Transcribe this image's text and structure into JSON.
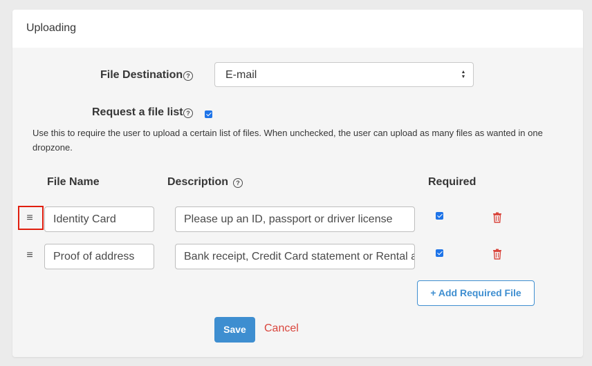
{
  "panel": {
    "title": "Uploading"
  },
  "destination": {
    "label": "File Destination",
    "help_icon": "question-circle-icon",
    "selected": "E-mail"
  },
  "file_list": {
    "label": "Request a file list",
    "help_icon": "question-circle-icon",
    "checked": true,
    "description": "Use this to require the user to upload a certain list of files. When unchecked, the user can upload as many files as wanted in one dropzone."
  },
  "table": {
    "headers": {
      "file_name": "File Name",
      "description": "Description",
      "required": "Required"
    },
    "rows": [
      {
        "file_name": "Identity Card",
        "description": "Please up an ID, passport or driver license",
        "required": true
      },
      {
        "file_name": "Proof of address",
        "description": "Bank receipt, Credit Card statement or Rental agreement",
        "required": true
      }
    ],
    "add_button": "+ Add Required File"
  },
  "actions": {
    "save": "Save",
    "cancel": "Cancel"
  },
  "colors": {
    "accent": "#3e8ed0",
    "danger": "#d9453c",
    "checkbox": "#1e74e8",
    "highlight": "#e01e0e"
  }
}
